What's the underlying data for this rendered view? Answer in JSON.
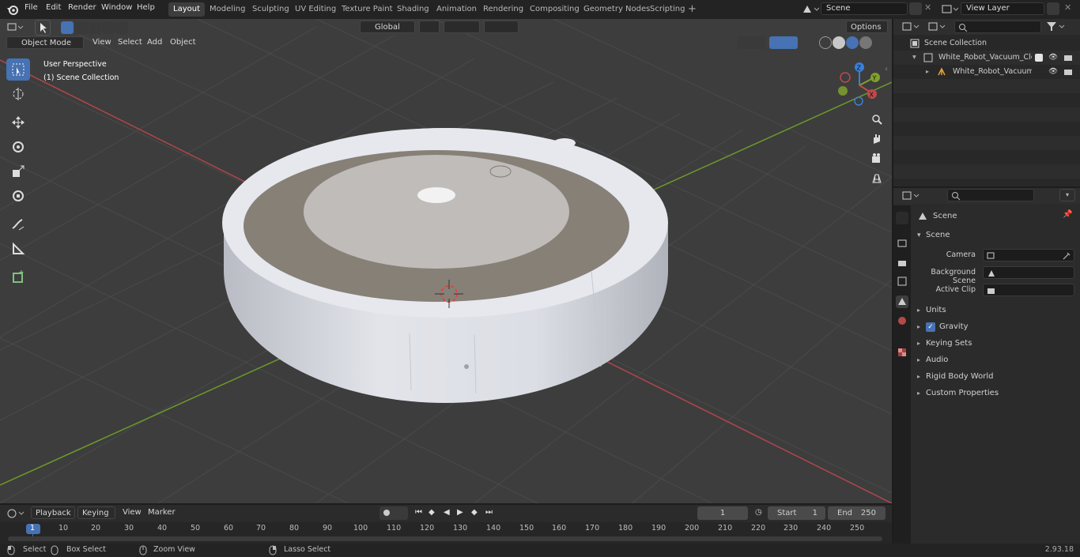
{
  "menus": [
    "File",
    "Edit",
    "Render",
    "Window",
    "Help"
  ],
  "workspaces": [
    "Layout",
    "Modeling",
    "Sculpting",
    "UV Editing",
    "Texture Paint",
    "Shading",
    "Animation",
    "Rendering",
    "Compositing",
    "Geometry Nodes",
    "Scripting"
  ],
  "active_workspace": "Layout",
  "scene_field": "Scene",
  "view_layer_field": "View Layer",
  "viewport": {
    "mode": "Object Mode",
    "menu": [
      "View",
      "Select",
      "Add",
      "Object"
    ],
    "transform_orientation": "Global",
    "options_label": "Options",
    "overlay_line1": "User Perspective",
    "overlay_line2": "(1) Scene Collection",
    "axis_labels": {
      "x": "X",
      "y": "Y",
      "z": "Z"
    }
  },
  "outliner": {
    "root": "Scene Collection",
    "items": [
      "White_Robot_Vacuum_Cleane",
      "White_Robot_Vacuum_C"
    ]
  },
  "properties": {
    "header": "Scene",
    "section": "Scene",
    "fields": [
      {
        "label": "Camera"
      },
      {
        "label": "Background Scene"
      },
      {
        "label": "Active Clip"
      }
    ],
    "panels": [
      "Units",
      "Gravity",
      "Keying Sets",
      "Audio",
      "Rigid Body World",
      "Custom Properties"
    ],
    "gravity_checked": true
  },
  "timeline": {
    "menu": [
      "Playback",
      "Keying",
      "View",
      "Marker"
    ],
    "current_frame": "1",
    "start_label": "Start",
    "start": "1",
    "end_label": "End",
    "end": "250",
    "ruler": [
      "1",
      "10",
      "20",
      "30",
      "40",
      "50",
      "60",
      "70",
      "80",
      "90",
      "100",
      "110",
      "120",
      "130",
      "140",
      "150",
      "160",
      "170",
      "180",
      "190",
      "200",
      "210",
      "220",
      "230",
      "240",
      "250"
    ]
  },
  "statusbar": {
    "select": "Select",
    "box_select": "Box Select",
    "zoom_view": "Zoom View",
    "lasso_select": "Lasso Select",
    "version": "2.93.18"
  },
  "colors": {
    "accent": "#4772b3",
    "viewport_bg": "#3d3d3d",
    "x_axis": "#c04a4a",
    "y_axis": "#7fa02e",
    "z_axis": "#3a7fd8"
  }
}
